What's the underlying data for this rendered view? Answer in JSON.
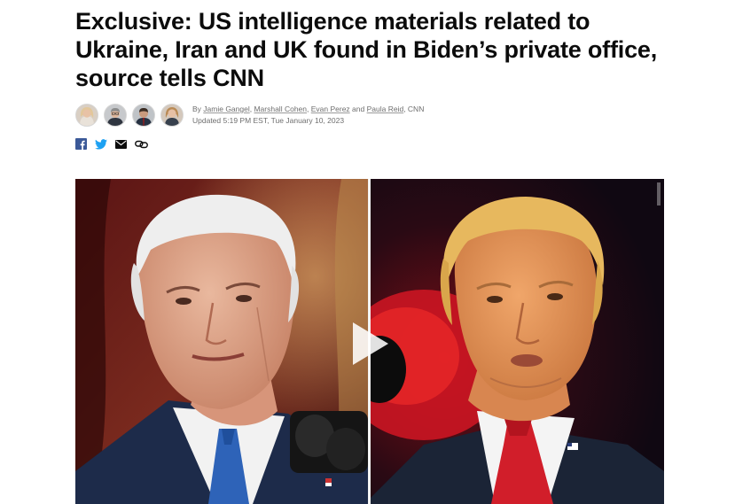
{
  "article": {
    "headline_lines": [
      "Exclusive: US intelligence materials related to",
      "Ukraine, Iran and UK found in Biden’s private office,",
      "source tells CNN"
    ],
    "byline": {
      "prefix": "By",
      "authors": [
        "Jamie Gangel",
        "Marshall Cohen",
        "Evan Perez",
        "Paula Reid"
      ],
      "separator_1": ", ",
      "separator_2": ", ",
      "separator_3": " and ",
      "suffix": ", CNN",
      "updated": "Updated 5:19 PM EST, Tue January 10, 2023"
    }
  },
  "share": {
    "icons": [
      "facebook-icon",
      "twitter-icon",
      "email-icon",
      "copy-link-icon"
    ]
  },
  "media": {
    "type": "video",
    "icon": "play-icon"
  },
  "colors": {
    "headline": "#0c0c0c",
    "byline": "#6e6e6e",
    "facebook": "#3b5998",
    "twitter": "#1da1f2"
  }
}
